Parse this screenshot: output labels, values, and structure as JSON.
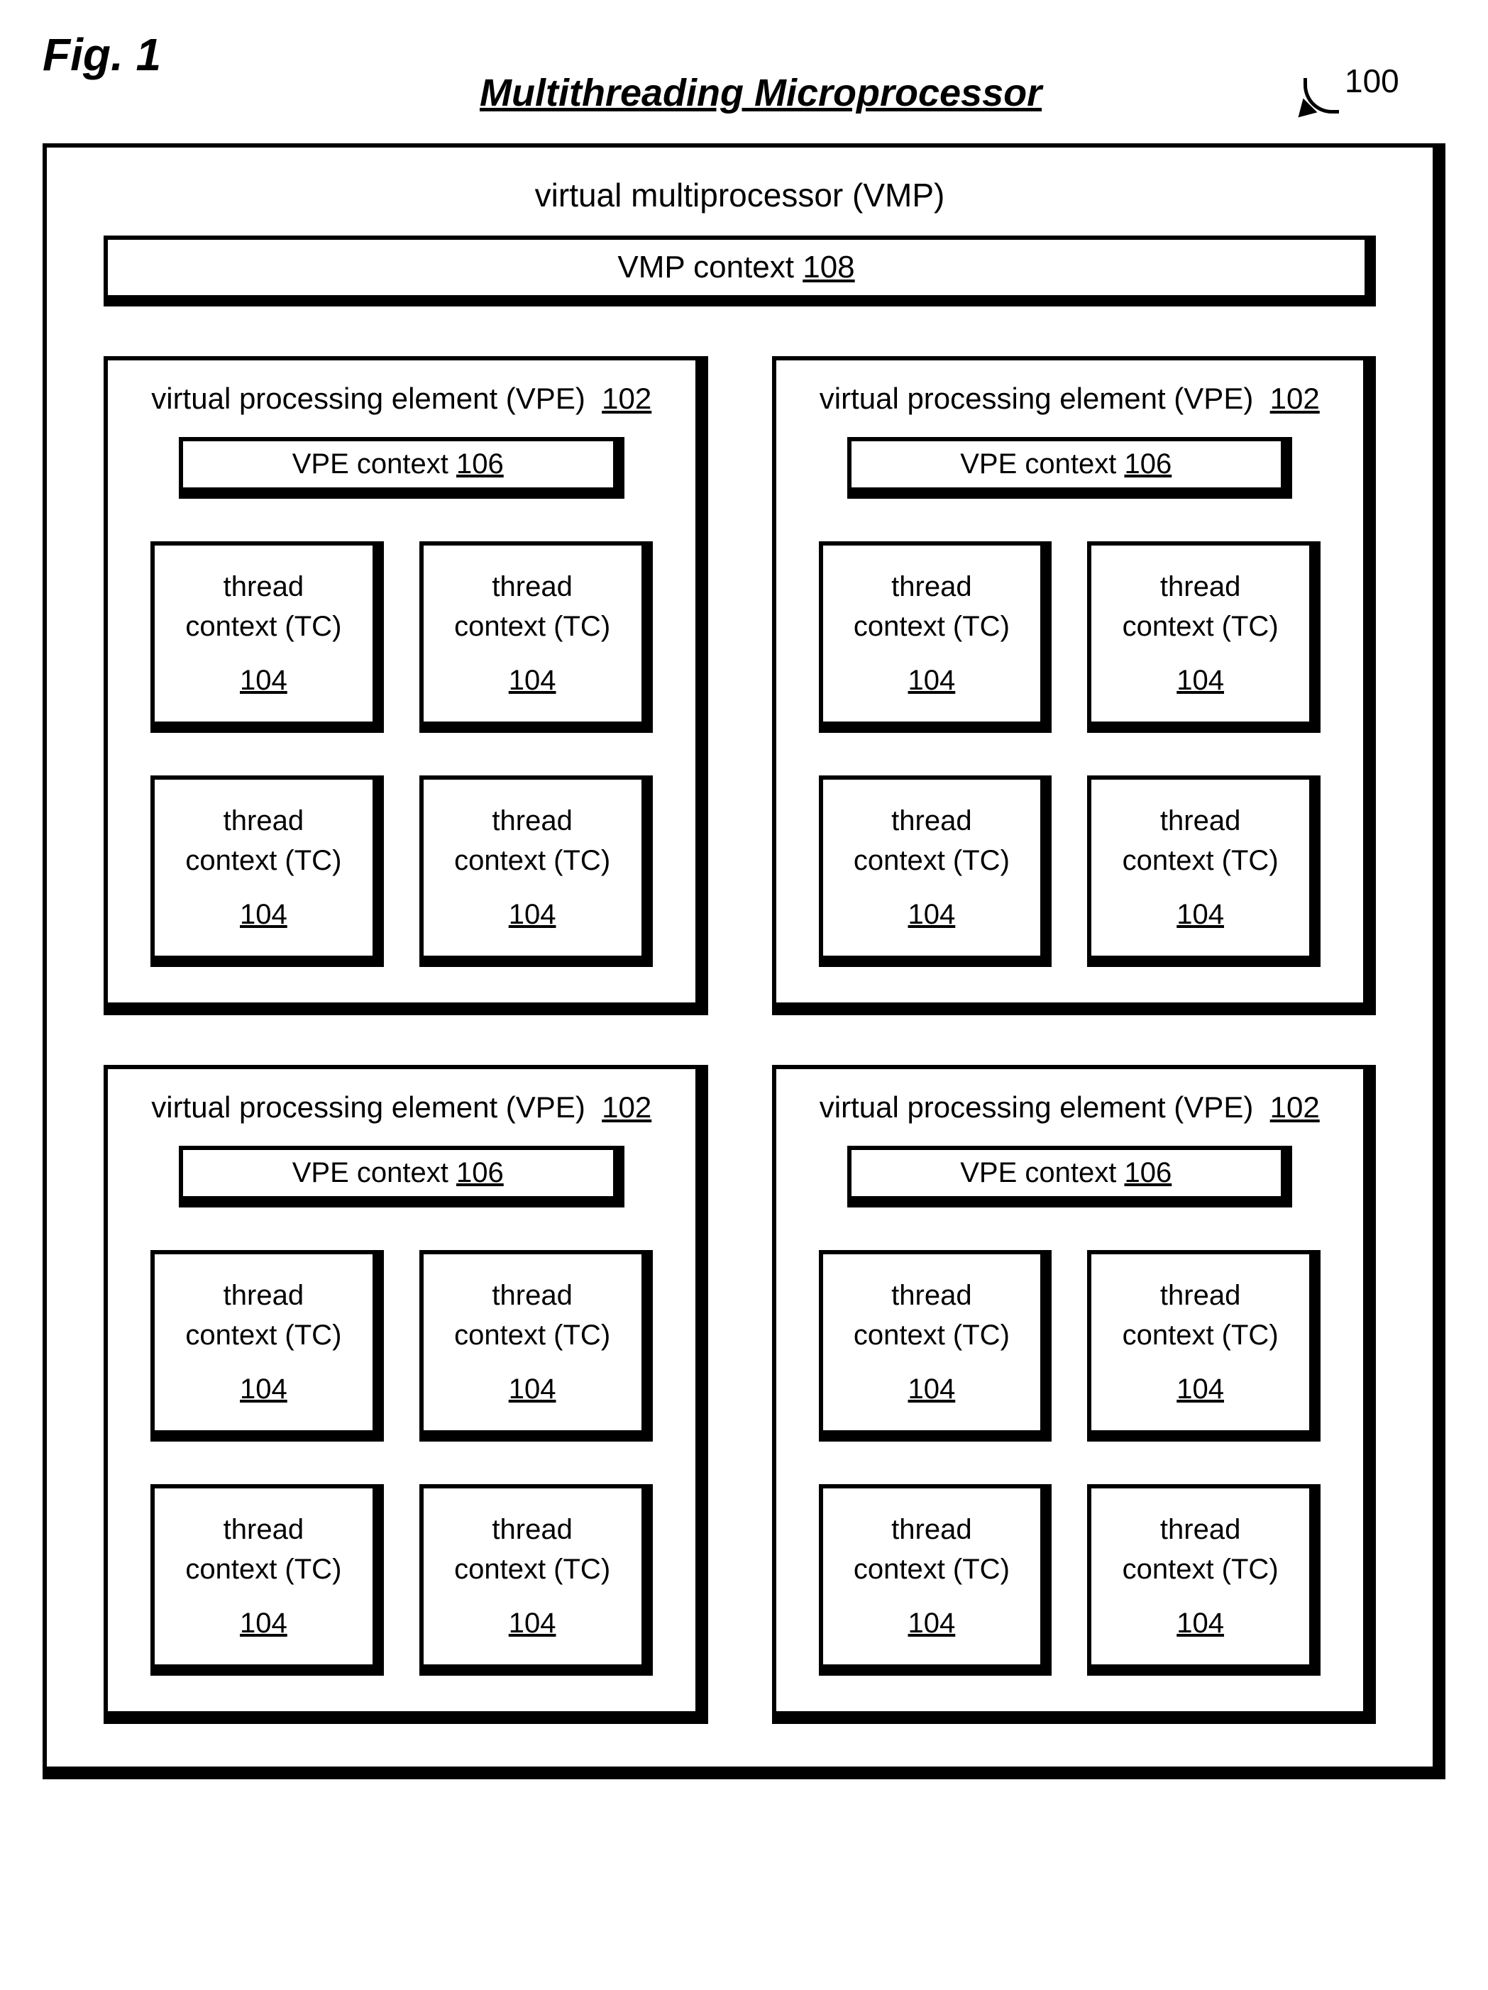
{
  "figure_label": "Fig. 1",
  "main_title": "Multithreading Microprocessor",
  "outer_ref_num": "100",
  "vmp": {
    "title": "virtual multiprocessor (VMP)",
    "context_label": "VMP context",
    "context_num": "108"
  },
  "vpe": {
    "title_prefix": "virtual processing element (VPE)",
    "title_num": "102",
    "context_label": "VPE context",
    "context_num": "106"
  },
  "tc": {
    "line1": "thread",
    "line2": "context (TC)",
    "num": "104"
  }
}
